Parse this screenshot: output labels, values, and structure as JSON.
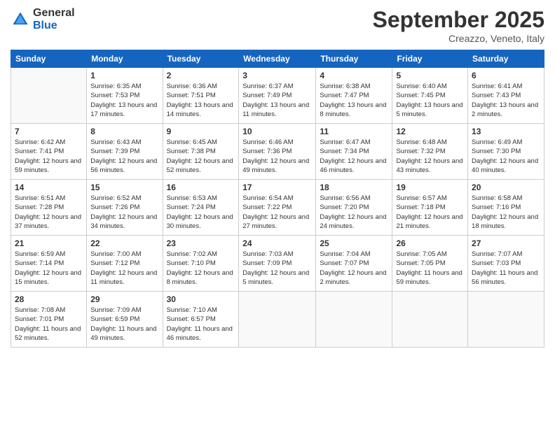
{
  "logo": {
    "general": "General",
    "blue": "Blue"
  },
  "header": {
    "month": "September 2025",
    "location": "Creazzo, Veneto, Italy"
  },
  "weekdays": [
    "Sunday",
    "Monday",
    "Tuesday",
    "Wednesday",
    "Thursday",
    "Friday",
    "Saturday"
  ],
  "weeks": [
    [
      {
        "day": "",
        "sunrise": "",
        "sunset": "",
        "daylight": ""
      },
      {
        "day": "1",
        "sunrise": "Sunrise: 6:35 AM",
        "sunset": "Sunset: 7:53 PM",
        "daylight": "Daylight: 13 hours and 17 minutes."
      },
      {
        "day": "2",
        "sunrise": "Sunrise: 6:36 AM",
        "sunset": "Sunset: 7:51 PM",
        "daylight": "Daylight: 13 hours and 14 minutes."
      },
      {
        "day": "3",
        "sunrise": "Sunrise: 6:37 AM",
        "sunset": "Sunset: 7:49 PM",
        "daylight": "Daylight: 13 hours and 11 minutes."
      },
      {
        "day": "4",
        "sunrise": "Sunrise: 6:38 AM",
        "sunset": "Sunset: 7:47 PM",
        "daylight": "Daylight: 13 hours and 8 minutes."
      },
      {
        "day": "5",
        "sunrise": "Sunrise: 6:40 AM",
        "sunset": "Sunset: 7:45 PM",
        "daylight": "Daylight: 13 hours and 5 minutes."
      },
      {
        "day": "6",
        "sunrise": "Sunrise: 6:41 AM",
        "sunset": "Sunset: 7:43 PM",
        "daylight": "Daylight: 13 hours and 2 minutes."
      }
    ],
    [
      {
        "day": "7",
        "sunrise": "Sunrise: 6:42 AM",
        "sunset": "Sunset: 7:41 PM",
        "daylight": "Daylight: 12 hours and 59 minutes."
      },
      {
        "day": "8",
        "sunrise": "Sunrise: 6:43 AM",
        "sunset": "Sunset: 7:39 PM",
        "daylight": "Daylight: 12 hours and 56 minutes."
      },
      {
        "day": "9",
        "sunrise": "Sunrise: 6:45 AM",
        "sunset": "Sunset: 7:38 PM",
        "daylight": "Daylight: 12 hours and 52 minutes."
      },
      {
        "day": "10",
        "sunrise": "Sunrise: 6:46 AM",
        "sunset": "Sunset: 7:36 PM",
        "daylight": "Daylight: 12 hours and 49 minutes."
      },
      {
        "day": "11",
        "sunrise": "Sunrise: 6:47 AM",
        "sunset": "Sunset: 7:34 PM",
        "daylight": "Daylight: 12 hours and 46 minutes."
      },
      {
        "day": "12",
        "sunrise": "Sunrise: 6:48 AM",
        "sunset": "Sunset: 7:32 PM",
        "daylight": "Daylight: 12 hours and 43 minutes."
      },
      {
        "day": "13",
        "sunrise": "Sunrise: 6:49 AM",
        "sunset": "Sunset: 7:30 PM",
        "daylight": "Daylight: 12 hours and 40 minutes."
      }
    ],
    [
      {
        "day": "14",
        "sunrise": "Sunrise: 6:51 AM",
        "sunset": "Sunset: 7:28 PM",
        "daylight": "Daylight: 12 hours and 37 minutes."
      },
      {
        "day": "15",
        "sunrise": "Sunrise: 6:52 AM",
        "sunset": "Sunset: 7:26 PM",
        "daylight": "Daylight: 12 hours and 34 minutes."
      },
      {
        "day": "16",
        "sunrise": "Sunrise: 6:53 AM",
        "sunset": "Sunset: 7:24 PM",
        "daylight": "Daylight: 12 hours and 30 minutes."
      },
      {
        "day": "17",
        "sunrise": "Sunrise: 6:54 AM",
        "sunset": "Sunset: 7:22 PM",
        "daylight": "Daylight: 12 hours and 27 minutes."
      },
      {
        "day": "18",
        "sunrise": "Sunrise: 6:56 AM",
        "sunset": "Sunset: 7:20 PM",
        "daylight": "Daylight: 12 hours and 24 minutes."
      },
      {
        "day": "19",
        "sunrise": "Sunrise: 6:57 AM",
        "sunset": "Sunset: 7:18 PM",
        "daylight": "Daylight: 12 hours and 21 minutes."
      },
      {
        "day": "20",
        "sunrise": "Sunrise: 6:58 AM",
        "sunset": "Sunset: 7:16 PM",
        "daylight": "Daylight: 12 hours and 18 minutes."
      }
    ],
    [
      {
        "day": "21",
        "sunrise": "Sunrise: 6:59 AM",
        "sunset": "Sunset: 7:14 PM",
        "daylight": "Daylight: 12 hours and 15 minutes."
      },
      {
        "day": "22",
        "sunrise": "Sunrise: 7:00 AM",
        "sunset": "Sunset: 7:12 PM",
        "daylight": "Daylight: 12 hours and 11 minutes."
      },
      {
        "day": "23",
        "sunrise": "Sunrise: 7:02 AM",
        "sunset": "Sunset: 7:10 PM",
        "daylight": "Daylight: 12 hours and 8 minutes."
      },
      {
        "day": "24",
        "sunrise": "Sunrise: 7:03 AM",
        "sunset": "Sunset: 7:09 PM",
        "daylight": "Daylight: 12 hours and 5 minutes."
      },
      {
        "day": "25",
        "sunrise": "Sunrise: 7:04 AM",
        "sunset": "Sunset: 7:07 PM",
        "daylight": "Daylight: 12 hours and 2 minutes."
      },
      {
        "day": "26",
        "sunrise": "Sunrise: 7:05 AM",
        "sunset": "Sunset: 7:05 PM",
        "daylight": "Daylight: 11 hours and 59 minutes."
      },
      {
        "day": "27",
        "sunrise": "Sunrise: 7:07 AM",
        "sunset": "Sunset: 7:03 PM",
        "daylight": "Daylight: 11 hours and 56 minutes."
      }
    ],
    [
      {
        "day": "28",
        "sunrise": "Sunrise: 7:08 AM",
        "sunset": "Sunset: 7:01 PM",
        "daylight": "Daylight: 11 hours and 52 minutes."
      },
      {
        "day": "29",
        "sunrise": "Sunrise: 7:09 AM",
        "sunset": "Sunset: 6:59 PM",
        "daylight": "Daylight: 11 hours and 49 minutes."
      },
      {
        "day": "30",
        "sunrise": "Sunrise: 7:10 AM",
        "sunset": "Sunset: 6:57 PM",
        "daylight": "Daylight: 11 hours and 46 minutes."
      },
      {
        "day": "",
        "sunrise": "",
        "sunset": "",
        "daylight": ""
      },
      {
        "day": "",
        "sunrise": "",
        "sunset": "",
        "daylight": ""
      },
      {
        "day": "",
        "sunrise": "",
        "sunset": "",
        "daylight": ""
      },
      {
        "day": "",
        "sunrise": "",
        "sunset": "",
        "daylight": ""
      }
    ]
  ]
}
